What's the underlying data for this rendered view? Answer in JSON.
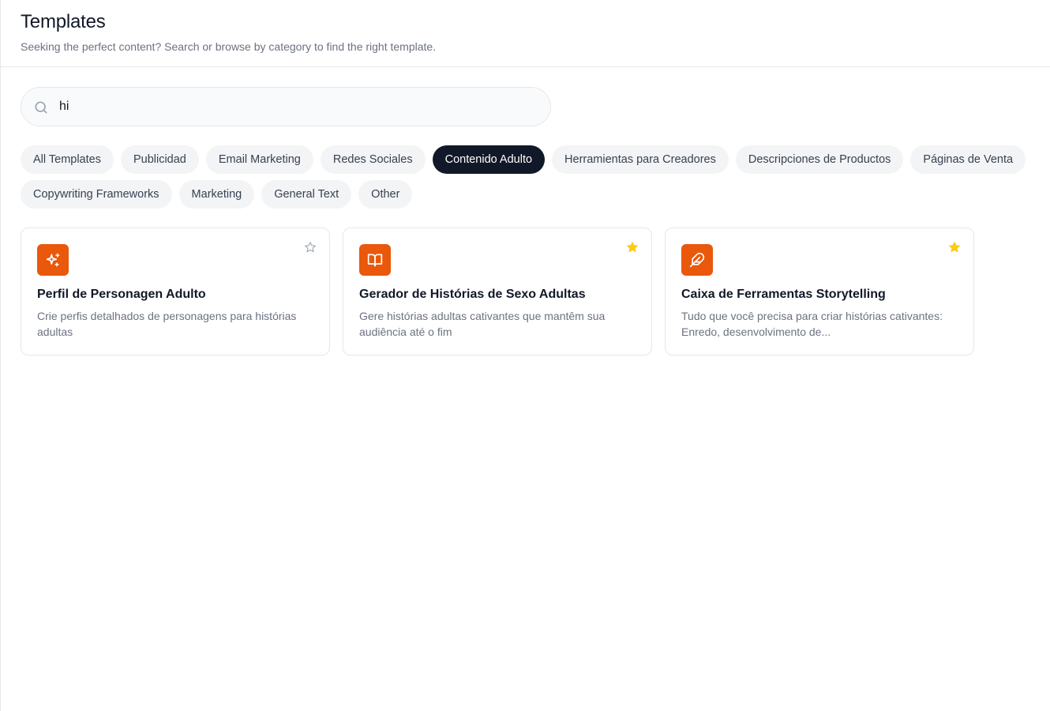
{
  "header": {
    "title": "Templates",
    "subtitle": "Seeking the perfect content? Search or browse by category to find the right template."
  },
  "search": {
    "value": "hi",
    "icon": "search-icon"
  },
  "categories": [
    {
      "label": "All Templates",
      "active": false
    },
    {
      "label": "Publicidad",
      "active": false
    },
    {
      "label": "Email Marketing",
      "active": false
    },
    {
      "label": "Redes Sociales",
      "active": false
    },
    {
      "label": "Contenido Adulto",
      "active": true
    },
    {
      "label": "Herramientas para Creadores",
      "active": false
    },
    {
      "label": "Descripciones de Productos",
      "active": false
    },
    {
      "label": "Páginas de Venta",
      "active": false
    },
    {
      "label": "Copywriting Frameworks",
      "active": false
    },
    {
      "label": "Marketing",
      "active": false
    },
    {
      "label": "General Text",
      "active": false
    },
    {
      "label": "Other",
      "active": false
    }
  ],
  "cards": [
    {
      "title": "Perfil de Personagen Adulto",
      "description": "Crie perfis detalhados de personagens para histórias adultas",
      "icon": "sparkles-icon",
      "favorite": false
    },
    {
      "title": "Gerador de Histórias de Sexo Adultas",
      "description": "Gere histórias adultas cativantes que mantêm sua audiência até o fim",
      "icon": "book-open-icon",
      "favorite": true
    },
    {
      "title": "Caixa de Ferramentas Storytelling",
      "description": "Tudo que você precisa para criar histórias cativantes: Enredo, desenvolvimento de...",
      "icon": "feather-icon",
      "favorite": true
    }
  ],
  "colors": {
    "accent": "#ea580c",
    "active_chip": "#111827",
    "star_filled": "#facc15",
    "star_empty": "#9ca3af"
  }
}
